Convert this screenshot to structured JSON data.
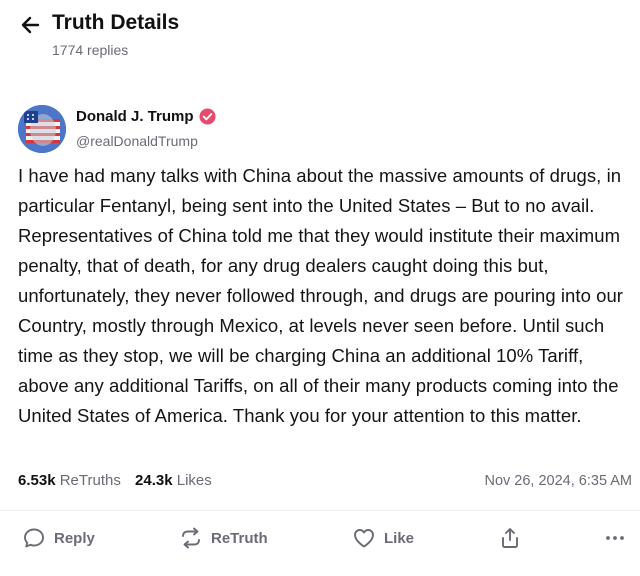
{
  "header": {
    "title": "Truth Details",
    "reply_count": "1774 replies"
  },
  "post": {
    "author_name": "Donald J. Trump",
    "author_handle": "@realDonaldTrump",
    "text": "I have had many talks with China about the massive amounts of drugs, in particular Fentanyl, being sent into the United States – But to no avail. Representatives of China told me that they would institute their maximum penalty, that of death, for any drug dealers caught doing this but, unfortunately, they never followed through, and drugs are pouring into our Country, mostly through Mexico, at levels never seen before. Until such time as they stop, we will be charging China an additional 10% Tariff, above any additional Tariffs, on all of their many products coming into the United States of America. Thank you for your attention to this matter.",
    "retruths_count": "6.53k",
    "retruths_label": "ReTruths",
    "likes_count": "24.3k",
    "likes_label": "Likes",
    "timestamp": "Nov 26, 2024, 6:35 AM"
  },
  "actions": {
    "reply_label": "Reply",
    "retruth_label": "ReTruth",
    "like_label": "Like"
  },
  "icons": {
    "back": "arrow-left-icon",
    "verified": "verified-badge-icon",
    "reply": "speech-bubble-icon",
    "retruth": "repost-arrows-icon",
    "like": "heart-icon",
    "share": "share-upload-icon",
    "more": "more-dots-icon"
  },
  "colors": {
    "verified_badge": "#e84a6d",
    "muted_text": "#6b6b76",
    "primary_text": "#111111"
  }
}
